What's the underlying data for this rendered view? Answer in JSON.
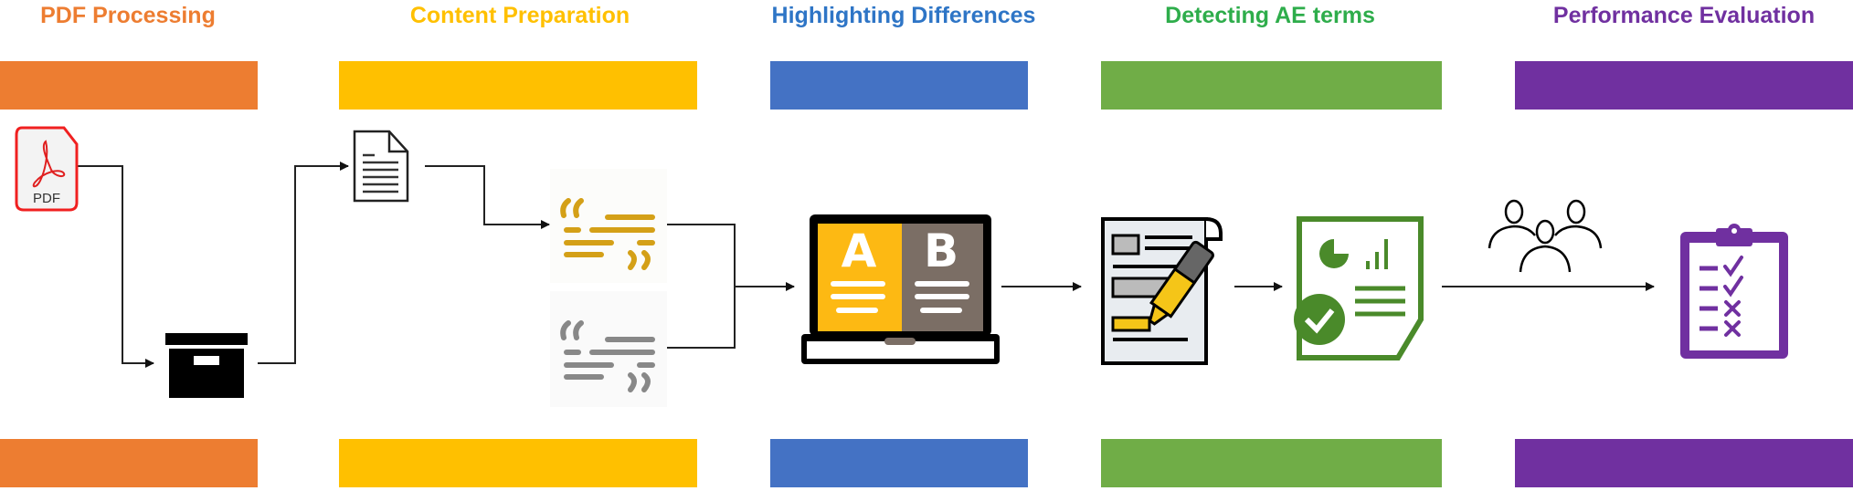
{
  "stages": [
    {
      "title": "PDF Processing",
      "color": "#ED7D31"
    },
    {
      "title": "Content Preparation",
      "color": "#FFC000"
    },
    {
      "title": "Highlighting Differences",
      "color": "#4472C4"
    },
    {
      "title": "Detecting AE terms",
      "color": "#70AD47"
    },
    {
      "title": "Performance Evaluation",
      "color": "#7030A0"
    }
  ],
  "icons": {
    "pdf_label": "PDF",
    "compare_a": "A",
    "compare_b": "B"
  }
}
